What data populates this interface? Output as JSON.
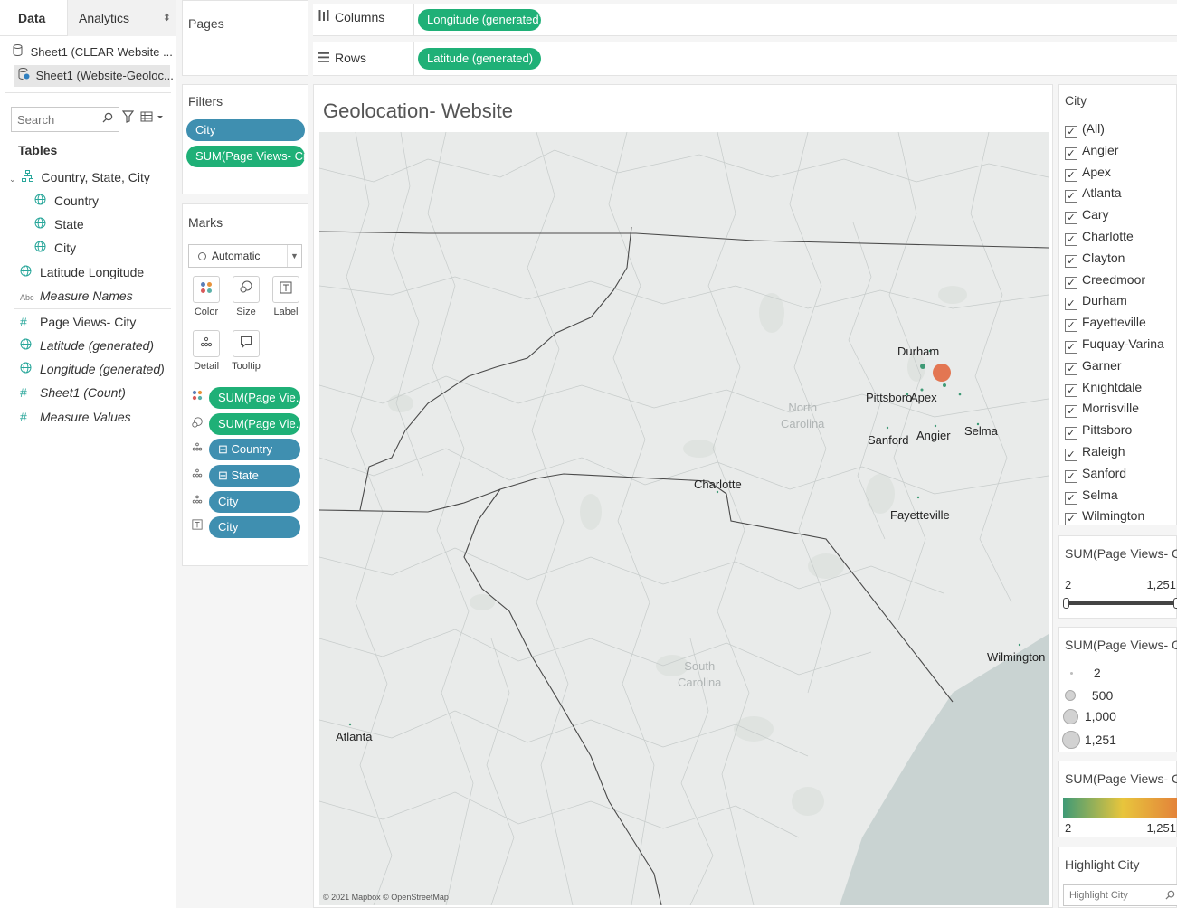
{
  "data_pane": {
    "tabs": [
      {
        "label": "Data",
        "active": true
      },
      {
        "label": "Analytics",
        "active": false
      }
    ],
    "tab_sort_glyph": "⬍",
    "data_sources": [
      {
        "label": "Sheet1 (CLEAR Website ...",
        "selected": false,
        "icon": "database-icon"
      },
      {
        "label": "Sheet1 (Website-Geoloc...",
        "selected": true,
        "icon": "database-check-icon"
      }
    ],
    "search_placeholder": "Search",
    "tables_heading": "Tables",
    "fields": [
      {
        "label": "Country, State, City",
        "icon": "hierarchy-icon",
        "indent": 0,
        "italic": false
      },
      {
        "label": "Country",
        "icon": "globe-icon",
        "indent": 1,
        "italic": false
      },
      {
        "label": "State",
        "icon": "globe-icon",
        "indent": 1,
        "italic": false
      },
      {
        "label": "City",
        "icon": "globe-icon",
        "indent": 1,
        "italic": false
      },
      {
        "label": "Latitude Longitude",
        "icon": "globe-icon",
        "indent": 0,
        "italic": false
      },
      {
        "label": "Measure Names",
        "icon": "abc-icon",
        "indent": 0,
        "italic": true
      },
      {
        "label": "Page Views- City",
        "icon": "hash-icon",
        "indent": 0,
        "italic": false
      },
      {
        "label": "Latitude (generated)",
        "icon": "globe-icon",
        "indent": 0,
        "italic": true
      },
      {
        "label": "Longitude (generated)",
        "icon": "globe-icon",
        "indent": 0,
        "italic": true
      },
      {
        "label": "Sheet1 (Count)",
        "icon": "hash-icon",
        "indent": 0,
        "italic": true
      },
      {
        "label": "Measure Values",
        "icon": "hash-icon",
        "indent": 0,
        "italic": true
      }
    ]
  },
  "pages": {
    "title": "Pages"
  },
  "filters": {
    "title": "Filters",
    "pills": [
      {
        "label": "City",
        "color": "blue"
      },
      {
        "label": "SUM(Page Views- Cit..",
        "color": "green"
      }
    ]
  },
  "marks": {
    "title": "Marks",
    "mark_type": "Automatic",
    "buttons": [
      {
        "label": "Color",
        "icon": "color-icon"
      },
      {
        "label": "Size",
        "icon": "size-icon"
      },
      {
        "label": "Label",
        "icon": "label-icon"
      },
      {
        "label": "Detail",
        "icon": "detail-icon"
      },
      {
        "label": "Tooltip",
        "icon": "tooltip-icon"
      }
    ],
    "pills": [
      {
        "label": "SUM(Page Vie..",
        "color": "green",
        "icon": "color-icon"
      },
      {
        "label": "SUM(Page Vie..",
        "color": "green",
        "icon": "size-icon"
      },
      {
        "label": "⊟ Country",
        "color": "blue",
        "icon": "detail-icon"
      },
      {
        "label": "⊟ State",
        "color": "blue",
        "icon": "detail-icon"
      },
      {
        "label": "City",
        "color": "blue",
        "icon": "detail-icon"
      },
      {
        "label": "City",
        "color": "blue",
        "icon": "label-icon"
      }
    ]
  },
  "shelves": {
    "columns": {
      "label": "Columns",
      "pill": "Longitude (generated)"
    },
    "rows": {
      "label": "Rows",
      "pill": "Latitude (generated)"
    }
  },
  "sheet": {
    "title": "Geolocation- Website",
    "copyright": "© 2021 Mapbox © OpenStreetMap",
    "state_labels": [
      "North\nCarolina",
      "South\nCarolina"
    ],
    "city_labels": [
      "Durham",
      "Pittsboro",
      "Apex",
      "Sanford",
      "Angier",
      "Selma",
      "Charlotte",
      "Fayetteville",
      "Wilmington",
      "Atlanta"
    ]
  },
  "city_filter": {
    "title": "City",
    "items": [
      "(All)",
      "Angier",
      "Apex",
      "Atlanta",
      "Cary",
      "Charlotte",
      "Clayton",
      "Creedmoor",
      "Durham",
      "Fayetteville",
      "Fuquay-Varina",
      "Garner",
      "Knightdale",
      "Morrisville",
      "Pittsboro",
      "Raleigh",
      "Sanford",
      "Selma",
      "Wilmington"
    ],
    "check_glyph": "✓"
  },
  "range_filter": {
    "title": "SUM(Page Views- City)",
    "min": "2",
    "max": "1,251"
  },
  "size_legend": {
    "title": "SUM(Page Views- City)",
    "items": [
      "2",
      "500",
      "1,000",
      "1,251"
    ]
  },
  "color_legend": {
    "title": "SUM(Page Views- City)",
    "min": "2",
    "max": "1,251",
    "colors": [
      "#3f9a76",
      "#e8c53c",
      "#e3823a"
    ]
  },
  "highlight": {
    "title": "Highlight City",
    "placeholder": "Highlight City"
  }
}
